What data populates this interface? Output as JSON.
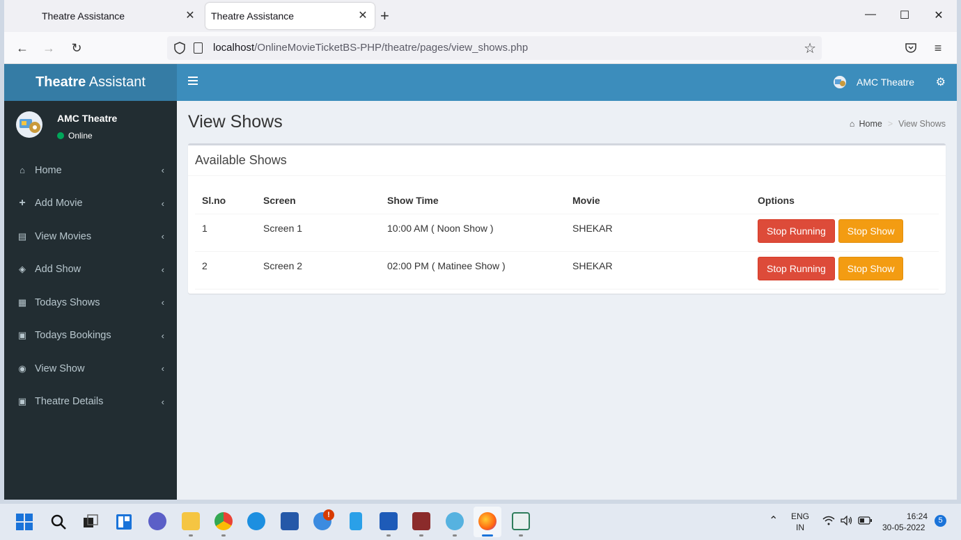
{
  "browser": {
    "tabs": [
      {
        "title": "Theatre Assistance"
      },
      {
        "title": "Theatre Assistance"
      }
    ],
    "new_tab_symbol": "+",
    "url_host": "localhost",
    "url_path": "/OnlineMovieTicketBS-PHP/theatre/pages/view_shows.php"
  },
  "app": {
    "logo_bold": "Theatre",
    "logo_rest": " Assistant",
    "top_user": "AMC Theatre",
    "sidebar_user": "AMC Theatre",
    "sidebar_status": "Online",
    "menu": [
      {
        "label": "Home",
        "icon": "home-icon"
      },
      {
        "label": "Add Movie",
        "icon": "plus-icon"
      },
      {
        "label": "View Movies",
        "icon": "list-icon"
      },
      {
        "label": "Add Show",
        "icon": "tag-icon"
      },
      {
        "label": "Todays Shows",
        "icon": "calendar-icon"
      },
      {
        "label": "Todays Bookings",
        "icon": "film-icon"
      },
      {
        "label": "View Show",
        "icon": "eye-icon"
      },
      {
        "label": "Theatre Details",
        "icon": "film-icon"
      }
    ]
  },
  "page": {
    "title": "View Shows",
    "breadcrumb_home": "Home",
    "breadcrumb_current": "View Shows",
    "box_title": "Available Shows",
    "columns": [
      "Sl.no",
      "Screen",
      "Show Time",
      "Movie",
      "Options"
    ],
    "rows": [
      {
        "slno": "1",
        "screen": "Screen 1",
        "show_time": "10:00 AM ( Noon Show )",
        "movie": "SHEKAR",
        "btn_stop_running": "Stop Running",
        "btn_stop_show": "Stop Show"
      },
      {
        "slno": "2",
        "screen": "Screen 2",
        "show_time": "02:00 PM ( Matinee Show )",
        "movie": "SHEKAR",
        "btn_stop_running": "Stop Running",
        "btn_stop_show": "Stop Show"
      }
    ]
  },
  "colors": {
    "header": "#3c8dbc",
    "logo": "#357ca5",
    "sidebar": "#222d32",
    "danger": "#dd4b39",
    "warning": "#f39c12"
  },
  "taskbar": {
    "lang_top": "ENG",
    "lang_bottom": "IN",
    "time": "16:24",
    "date": "30-05-2022",
    "notification_count": "5",
    "help_badge": "!"
  }
}
